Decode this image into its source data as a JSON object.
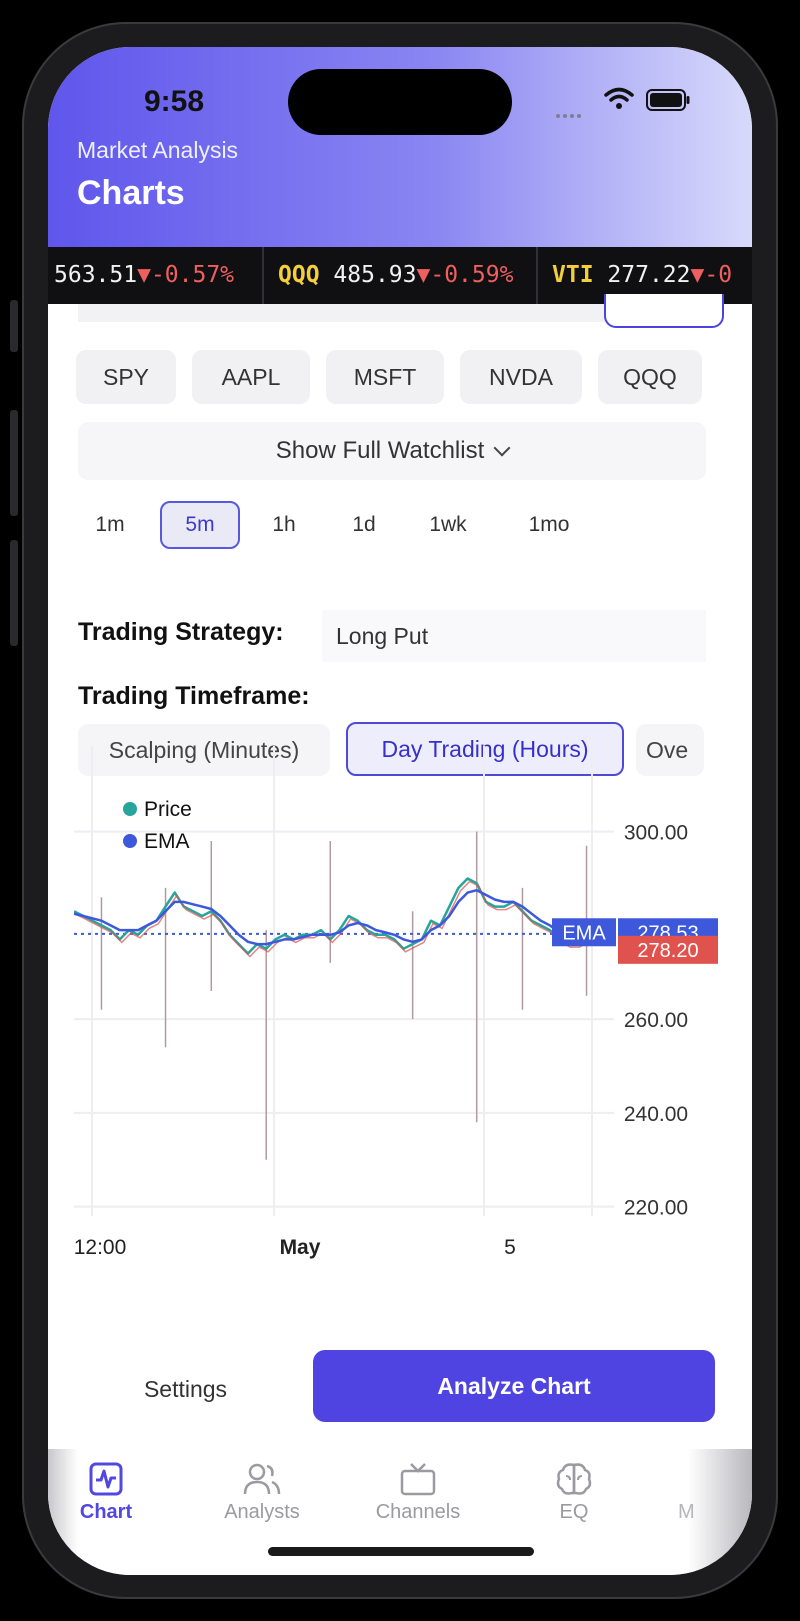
{
  "status_bar": {
    "time": "9:58"
  },
  "header": {
    "subtitle": "Market Analysis",
    "title": "Charts"
  },
  "ticker": [
    {
      "symbol": "",
      "price": "563.51",
      "change": "▼-0.57%"
    },
    {
      "symbol": "QQQ",
      "price": "485.93",
      "change": "▼-0.59%"
    },
    {
      "symbol": "VTI",
      "price": "277.22",
      "change": "▼-0"
    }
  ],
  "watchlist_chips": [
    "SPY",
    "AAPL",
    "MSFT",
    "NVDA",
    "QQQ"
  ],
  "watchlist_toggle": "Show Full Watchlist",
  "intervals": {
    "options": [
      "1m",
      "5m",
      "1h",
      "1d",
      "1wk",
      "1mo"
    ],
    "selected": "5m"
  },
  "strategy": {
    "label": "Trading Strategy:",
    "value": "Long Put"
  },
  "timeframe": {
    "label": "Trading Timeframe:",
    "options": [
      "Scalping (Minutes)",
      "Day Trading (Hours)",
      "Ove"
    ],
    "selected": "Day Trading (Hours)"
  },
  "chart_data": {
    "type": "line",
    "legend": [
      "Price",
      "EMA"
    ],
    "legend_position": "top-left",
    "x_ticks": [
      "12:00",
      "May",
      "5"
    ],
    "y_ticks": [
      "300.00",
      "260.00",
      "240.00",
      "220.00"
    ],
    "ylim": [
      218,
      314
    ],
    "grid": true,
    "series": [
      {
        "name": "Price",
        "color": "#26a69a",
        "values": [
          283,
          282,
          281,
          280,
          279,
          277,
          279,
          278,
          280,
          281,
          284,
          287,
          284,
          283,
          282,
          283,
          281,
          278,
          276,
          274,
          276,
          275,
          277,
          278,
          277,
          278,
          278,
          279,
          277,
          279,
          282,
          281,
          279,
          278,
          278,
          277,
          275,
          276,
          277,
          281,
          280,
          284,
          288,
          290,
          289,
          285,
          284,
          284,
          285,
          283,
          281,
          280,
          279,
          277,
          276,
          276,
          277,
          278,
          277,
          278
        ]
      },
      {
        "name": "EMA",
        "color": "#3e58dc",
        "values": [
          282.5,
          282,
          281.5,
          281,
          280,
          279,
          279,
          279,
          280,
          281,
          283,
          285,
          285,
          284.5,
          284,
          283.5,
          282,
          280,
          278,
          276.5,
          276,
          276,
          276.5,
          277,
          277,
          277.5,
          278,
          278,
          278,
          278.5,
          280,
          280.5,
          280,
          279,
          278.5,
          278,
          277,
          276.5,
          277,
          279,
          280,
          282,
          285,
          287,
          287.5,
          286.5,
          285.5,
          285,
          285,
          284,
          282.5,
          281,
          280,
          278.5,
          277.5,
          277,
          277,
          277.5,
          277.5,
          278.5
        ]
      }
    ],
    "wicks": [
      {
        "i": 3,
        "low": 262,
        "high": 286
      },
      {
        "i": 10,
        "low": 254,
        "high": 288
      },
      {
        "i": 15,
        "low": 266,
        "high": 298
      },
      {
        "i": 21,
        "low": 230,
        "high": 279
      },
      {
        "i": 28,
        "low": 272,
        "high": 298
      },
      {
        "i": 37,
        "low": 260,
        "high": 283
      },
      {
        "i": 44,
        "low": 238,
        "high": 300
      },
      {
        "i": 49,
        "low": 262,
        "high": 288
      },
      {
        "i": 56,
        "low": 265,
        "high": 297
      }
    ],
    "reference_line": 278.2,
    "ema_label": {
      "text": "EMA",
      "value": "278.53",
      "color": "#3e58dc"
    },
    "price_label": {
      "value": "278.20",
      "color": "#e0524e"
    }
  },
  "actions": {
    "settings": "Settings",
    "analyze": "Analyze Chart"
  },
  "tabbar": [
    {
      "label": "Chart",
      "icon": "chart-icon",
      "active": true
    },
    {
      "label": "Analysts",
      "icon": "users-icon",
      "active": false
    },
    {
      "label": "Channels",
      "icon": "tv-icon",
      "active": false
    },
    {
      "label": "EQ",
      "icon": "brain-icon",
      "active": false
    },
    {
      "label": "M",
      "icon": "more-icon",
      "active": false
    }
  ]
}
